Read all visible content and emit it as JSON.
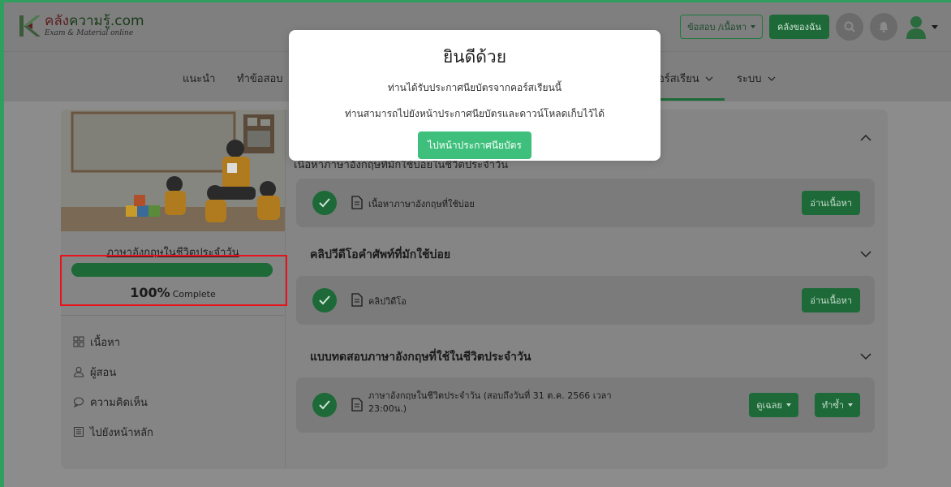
{
  "header": {
    "logo_main_accent": "คลัง",
    "logo_main_rest": "ความรู้.com",
    "logo_sub": "Exam & Material online",
    "select_label": "ข้อสอบ /เนื้อหา",
    "library_label": "คลังของฉัน",
    "icons": [
      "search-icon",
      "bell-icon",
      "user-icon",
      "caret-down-icon"
    ]
  },
  "nav": {
    "items": [
      "แนะนำ",
      "ทำข้อสอบ",
      "อร์สเรียน",
      "ระบบ"
    ]
  },
  "sidebar": {
    "course_title": "ภาษาอังกฤษในชีวิตประจำวัน",
    "progress_value": 100,
    "progress_pct": "100%",
    "progress_label": "Complete",
    "menu": [
      {
        "icon": "grid-icon",
        "label": "เนื้อหา"
      },
      {
        "icon": "person-icon",
        "label": "ผู้สอน"
      },
      {
        "icon": "comment-icon",
        "label": "ความคิดเห็น"
      },
      {
        "icon": "newspaper-icon",
        "label": "ไปยังหน้าหลัก"
      }
    ]
  },
  "content": {
    "section1_partial_title": "เนื้อหาภาษาอังกฤษที่มักใช้บ่อยในชีวิตประจำวัน",
    "lesson1": {
      "title": "เนื้อหาภาษาอังกฤษที่ใช้บ่อย",
      "button": "อ่านเนื้อหา"
    },
    "section2_title": "คลิปวีดีโอคำศัพท์ที่มักใช้บ่อย",
    "lesson2": {
      "title": "คลิปวิดีโอ",
      "button": "อ่านเนื้อหา"
    },
    "section3_title": "แบบทดสอบภาษาอังกฤษที่ใช้ในชีวิตประจำวัน",
    "lesson3": {
      "title_line1": "ภาษาอังกฤษในชีวิตประจำวัน (สอบถึงวันที่ 31 ต.ค. 2566 เวลา",
      "title_line2": "23:00น.)",
      "answer_button": "ดูเฉลย",
      "retake_button": "ทำซ้ำ"
    }
  },
  "modal": {
    "title": "ยินดีด้วย",
    "line1": "ท่านได้รับประกาศนียบัตรจากคอร์สเรียนนี้",
    "line2": "ท่านสามารถไปยังหน้าประกาศนียบัตรและดาวน์โหลดเก็บไว้ได้",
    "button": "ไปหน้าประกาศนียบัตร"
  },
  "colors": {
    "accent_green": "#3ec07c",
    "dark_green": "#1d6a38",
    "highlight_red": "#e8121c",
    "overlay": "#8c8c8c"
  }
}
